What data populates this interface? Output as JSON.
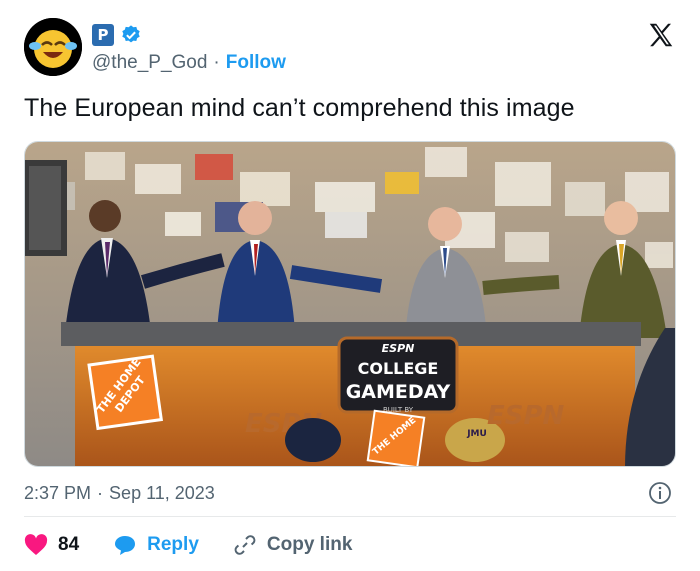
{
  "author": {
    "badge_letter": "P",
    "handle": "@the_P_God",
    "separator": "·",
    "follow_label": "Follow",
    "avatar_icon": "laughing-emoji-avatar",
    "verified_icon": "verified-badge-icon",
    "verified_color": "#1d9bf0"
  },
  "platform_logo": "x-logo-icon",
  "tweet": {
    "text": "The European mind can’t comprehend this image"
  },
  "media": {
    "description_icon": "sports-broadcast-photo",
    "signs": {
      "esp_top": "ESPN",
      "college": "COLLEGE",
      "gameday": "GAMEDAY",
      "built_by": "BUILT BY",
      "the_home": "THE HOME",
      "depot": "DEPOT",
      "jmu": "JMU",
      "espn_left": "ESPN",
      "espn_right": "ESPN"
    }
  },
  "meta": {
    "time": "2:37 PM",
    "separator": "·",
    "date": "Sep 11, 2023",
    "info_icon": "info-icon"
  },
  "actions": {
    "likes_count": "84",
    "likes_icon": "heart-icon",
    "like_color": "#f91880",
    "reply_label": "Reply",
    "reply_icon": "reply-bubble-icon",
    "copy_label": "Copy link",
    "copy_icon": "link-icon"
  }
}
